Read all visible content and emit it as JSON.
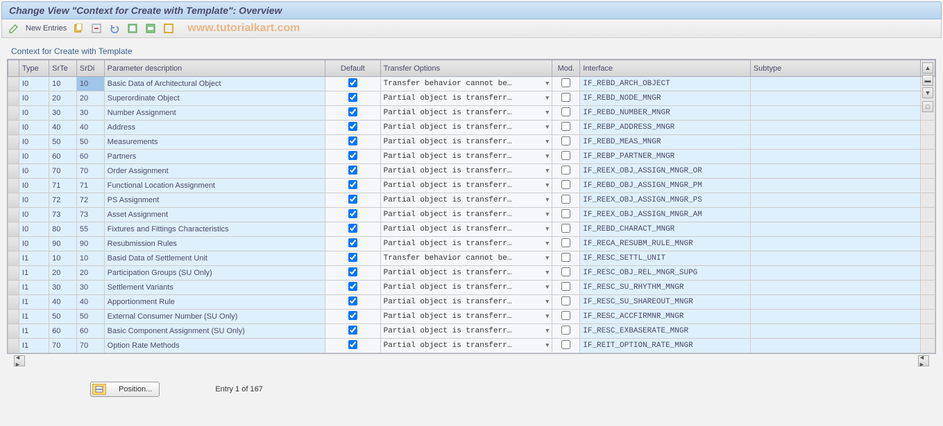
{
  "title": "Change View \"Context for Create with Template\": Overview",
  "toolbar": {
    "new_entries": "New Entries"
  },
  "watermark": "www.tutorialkart.com",
  "table": {
    "title": "Context for Create with Template",
    "columns": {
      "type": "Type",
      "srte": "SrTe",
      "srdi": "SrDi",
      "param": "Parameter description",
      "default": "Default",
      "transfer": "Transfer Options",
      "mod": "Mod.",
      "interface": "Interface",
      "subtype": "Subtype"
    },
    "rows": [
      {
        "type": "I0",
        "srte": "10",
        "srdi": "10",
        "param": "Basic Data of Architectural Object",
        "default": true,
        "transfer": "Transfer behavior cannot be…",
        "mod": false,
        "interface": "IF_REBD_ARCH_OBJECT",
        "subtype": "",
        "selected": true
      },
      {
        "type": "I0",
        "srte": "20",
        "srdi": "20",
        "param": "Superordinate Object",
        "default": true,
        "transfer": "Partial object is transferr…",
        "mod": false,
        "interface": "IF_REBD_NODE_MNGR",
        "subtype": ""
      },
      {
        "type": "I0",
        "srte": "30",
        "srdi": "30",
        "param": "Number Assignment",
        "default": true,
        "transfer": "Partial object is transferr…",
        "mod": false,
        "interface": "IF_REBD_NUMBER_MNGR",
        "subtype": ""
      },
      {
        "type": "I0",
        "srte": "40",
        "srdi": "40",
        "param": "Address",
        "default": true,
        "transfer": "Partial object is transferr…",
        "mod": false,
        "interface": "IF_REBP_ADDRESS_MNGR",
        "subtype": ""
      },
      {
        "type": "I0",
        "srte": "50",
        "srdi": "50",
        "param": "Measurements",
        "default": true,
        "transfer": "Partial object is transferr…",
        "mod": false,
        "interface": "IF_REBD_MEAS_MNGR",
        "subtype": ""
      },
      {
        "type": "I0",
        "srte": "60",
        "srdi": "60",
        "param": "Partners",
        "default": true,
        "transfer": "Partial object is transferr…",
        "mod": false,
        "interface": "IF_REBP_PARTNER_MNGR",
        "subtype": ""
      },
      {
        "type": "I0",
        "srte": "70",
        "srdi": "70",
        "param": "Order Assignment",
        "default": true,
        "transfer": "Partial object is transferr…",
        "mod": false,
        "interface": "IF_REEX_OBJ_ASSIGN_MNGR_OR",
        "subtype": ""
      },
      {
        "type": "I0",
        "srte": "71",
        "srdi": "71",
        "param": "Functional Location Assignment",
        "default": true,
        "transfer": "Partial object is transferr…",
        "mod": false,
        "interface": "IF_REBD_OBJ_ASSIGN_MNGR_PM",
        "subtype": ""
      },
      {
        "type": "I0",
        "srte": "72",
        "srdi": "72",
        "param": "PS Assignment",
        "default": true,
        "transfer": "Partial object is transferr…",
        "mod": false,
        "interface": "IF_REEX_OBJ_ASSIGN_MNGR_PS",
        "subtype": ""
      },
      {
        "type": "I0",
        "srte": "73",
        "srdi": "73",
        "param": "Asset Assignment",
        "default": true,
        "transfer": "Partial object is transferr…",
        "mod": false,
        "interface": "IF_REEX_OBJ_ASSIGN_MNGR_AM",
        "subtype": ""
      },
      {
        "type": "I0",
        "srte": "80",
        "srdi": "55",
        "param": "Fixtures and Fittings Characteristics",
        "default": true,
        "transfer": "Partial object is transferr…",
        "mod": false,
        "interface": "IF_REBD_CHARACT_MNGR",
        "subtype": ""
      },
      {
        "type": "I0",
        "srte": "90",
        "srdi": "90",
        "param": "Resubmission Rules",
        "default": true,
        "transfer": "Partial object is transferr…",
        "mod": false,
        "interface": "IF_RECA_RESUBM_RULE_MNGR",
        "subtype": ""
      },
      {
        "type": "I1",
        "srte": "10",
        "srdi": "10",
        "param": "Basid Data of Settlement Unit",
        "default": true,
        "transfer": "Transfer behavior cannot be…",
        "mod": false,
        "interface": "IF_RESC_SETTL_UNIT",
        "subtype": ""
      },
      {
        "type": "I1",
        "srte": "20",
        "srdi": "20",
        "param": "Participation Groups (SU Only)",
        "default": true,
        "transfer": "Partial object is transferr…",
        "mod": false,
        "interface": "IF_RESC_OBJ_REL_MNGR_SUPG",
        "subtype": ""
      },
      {
        "type": "I1",
        "srte": "30",
        "srdi": "30",
        "param": "Settlement Variants",
        "default": true,
        "transfer": "Partial object is transferr…",
        "mod": false,
        "interface": "IF_RESC_SU_RHYTHM_MNGR",
        "subtype": ""
      },
      {
        "type": "I1",
        "srte": "40",
        "srdi": "40",
        "param": "Apportionment Rule",
        "default": true,
        "transfer": "Partial object is transferr…",
        "mod": false,
        "interface": "IF_RESC_SU_SHAREOUT_MNGR",
        "subtype": ""
      },
      {
        "type": "I1",
        "srte": "50",
        "srdi": "50",
        "param": "External Consumer Number (SU Only)",
        "default": true,
        "transfer": "Partial object is transferr…",
        "mod": false,
        "interface": "IF_RESC_ACCFIRMNR_MNGR",
        "subtype": ""
      },
      {
        "type": "I1",
        "srte": "60",
        "srdi": "60",
        "param": "Basic Component Assignment (SU Only)",
        "default": true,
        "transfer": "Partial object is transferr…",
        "mod": false,
        "interface": "IF_RESC_EXBASERATE_MNGR",
        "subtype": ""
      },
      {
        "type": "I1",
        "srte": "70",
        "srdi": "70",
        "param": "Option Rate Methods",
        "default": true,
        "transfer": "Partial object is transferr…",
        "mod": false,
        "interface": "IF_REIT_OPTION_RATE_MNGR",
        "subtype": ""
      }
    ]
  },
  "footer": {
    "position_label": "Position...",
    "entry_text": "Entry 1 of 167"
  }
}
